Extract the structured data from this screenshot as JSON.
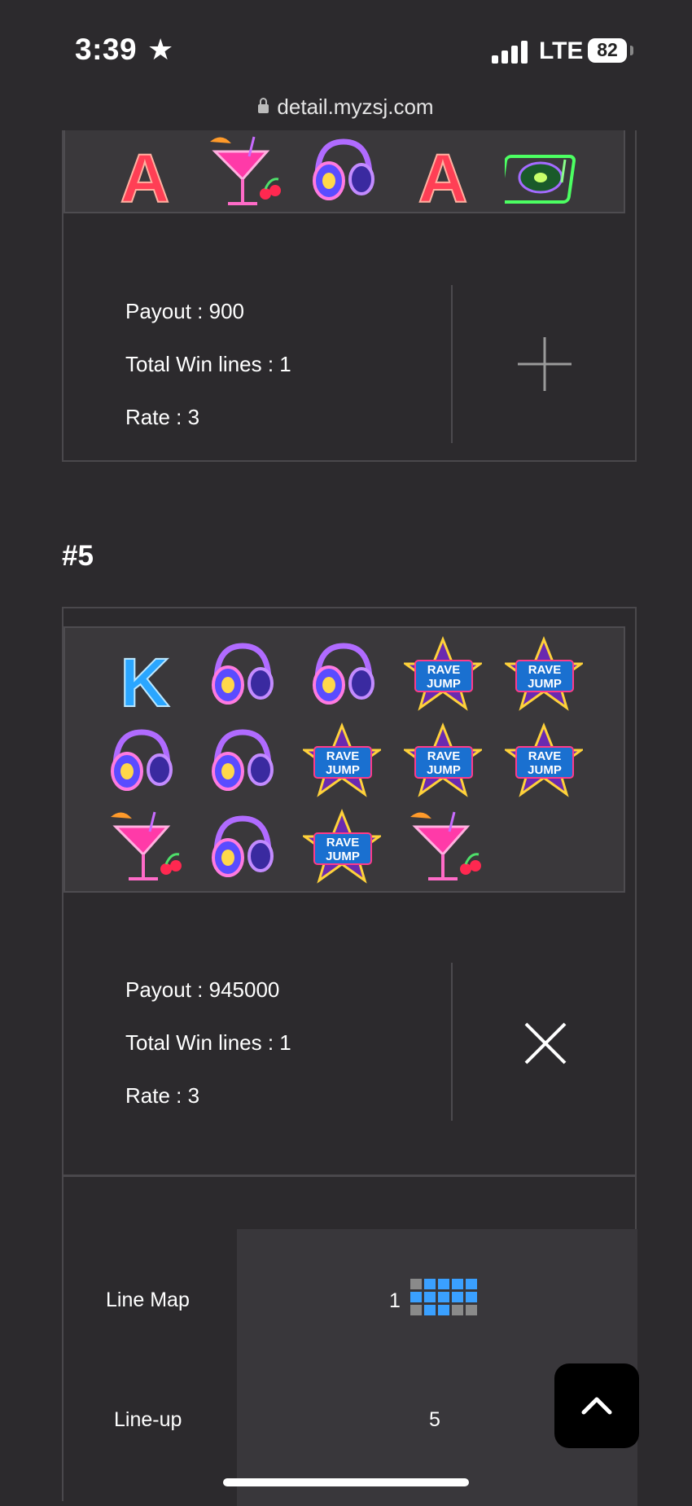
{
  "status_bar": {
    "time": "3:39",
    "network": "LTE",
    "battery": "82"
  },
  "browser": {
    "url": "detail.myzsj.com"
  },
  "result_4": {
    "top_symbols": [
      "A",
      "cocktail",
      "headphones",
      "A",
      "turntable"
    ],
    "payout_label": "Payout : 900",
    "win_lines_label": "Total Win lines : 1",
    "rate_label": "Rate : 3",
    "toggle": "expand"
  },
  "result_5": {
    "title": "#5",
    "grid": [
      [
        "K",
        "headphones",
        "headphones",
        "rave-jump",
        "rave-jump"
      ],
      [
        "headphones",
        "headphones",
        "rave-jump",
        "rave-jump",
        "rave-jump"
      ],
      [
        "cocktail",
        "headphones",
        "rave-jump",
        "cocktail"
      ]
    ],
    "rave_jump_text": [
      "RAVE",
      "JUMP"
    ],
    "k_text": "K",
    "a_text": "A",
    "payout_label": "Payout : 945000",
    "win_lines_label": "Total Win lines : 1",
    "rate_label": "Rate : 3",
    "toggle": "collapse",
    "line_map_label": "Line Map",
    "line_map_index": "1",
    "line_map_pattern": [
      [
        0,
        1,
        1,
        1,
        1
      ],
      [
        1,
        1,
        1,
        1,
        1
      ],
      [
        0,
        1,
        1,
        0,
        0
      ]
    ],
    "lineup_label": "Line-up",
    "lineup_value": "5"
  },
  "colors": {
    "background": "#2c2a2d",
    "highlight": "#3aa0ff",
    "inactive": "#8a8a8a"
  }
}
